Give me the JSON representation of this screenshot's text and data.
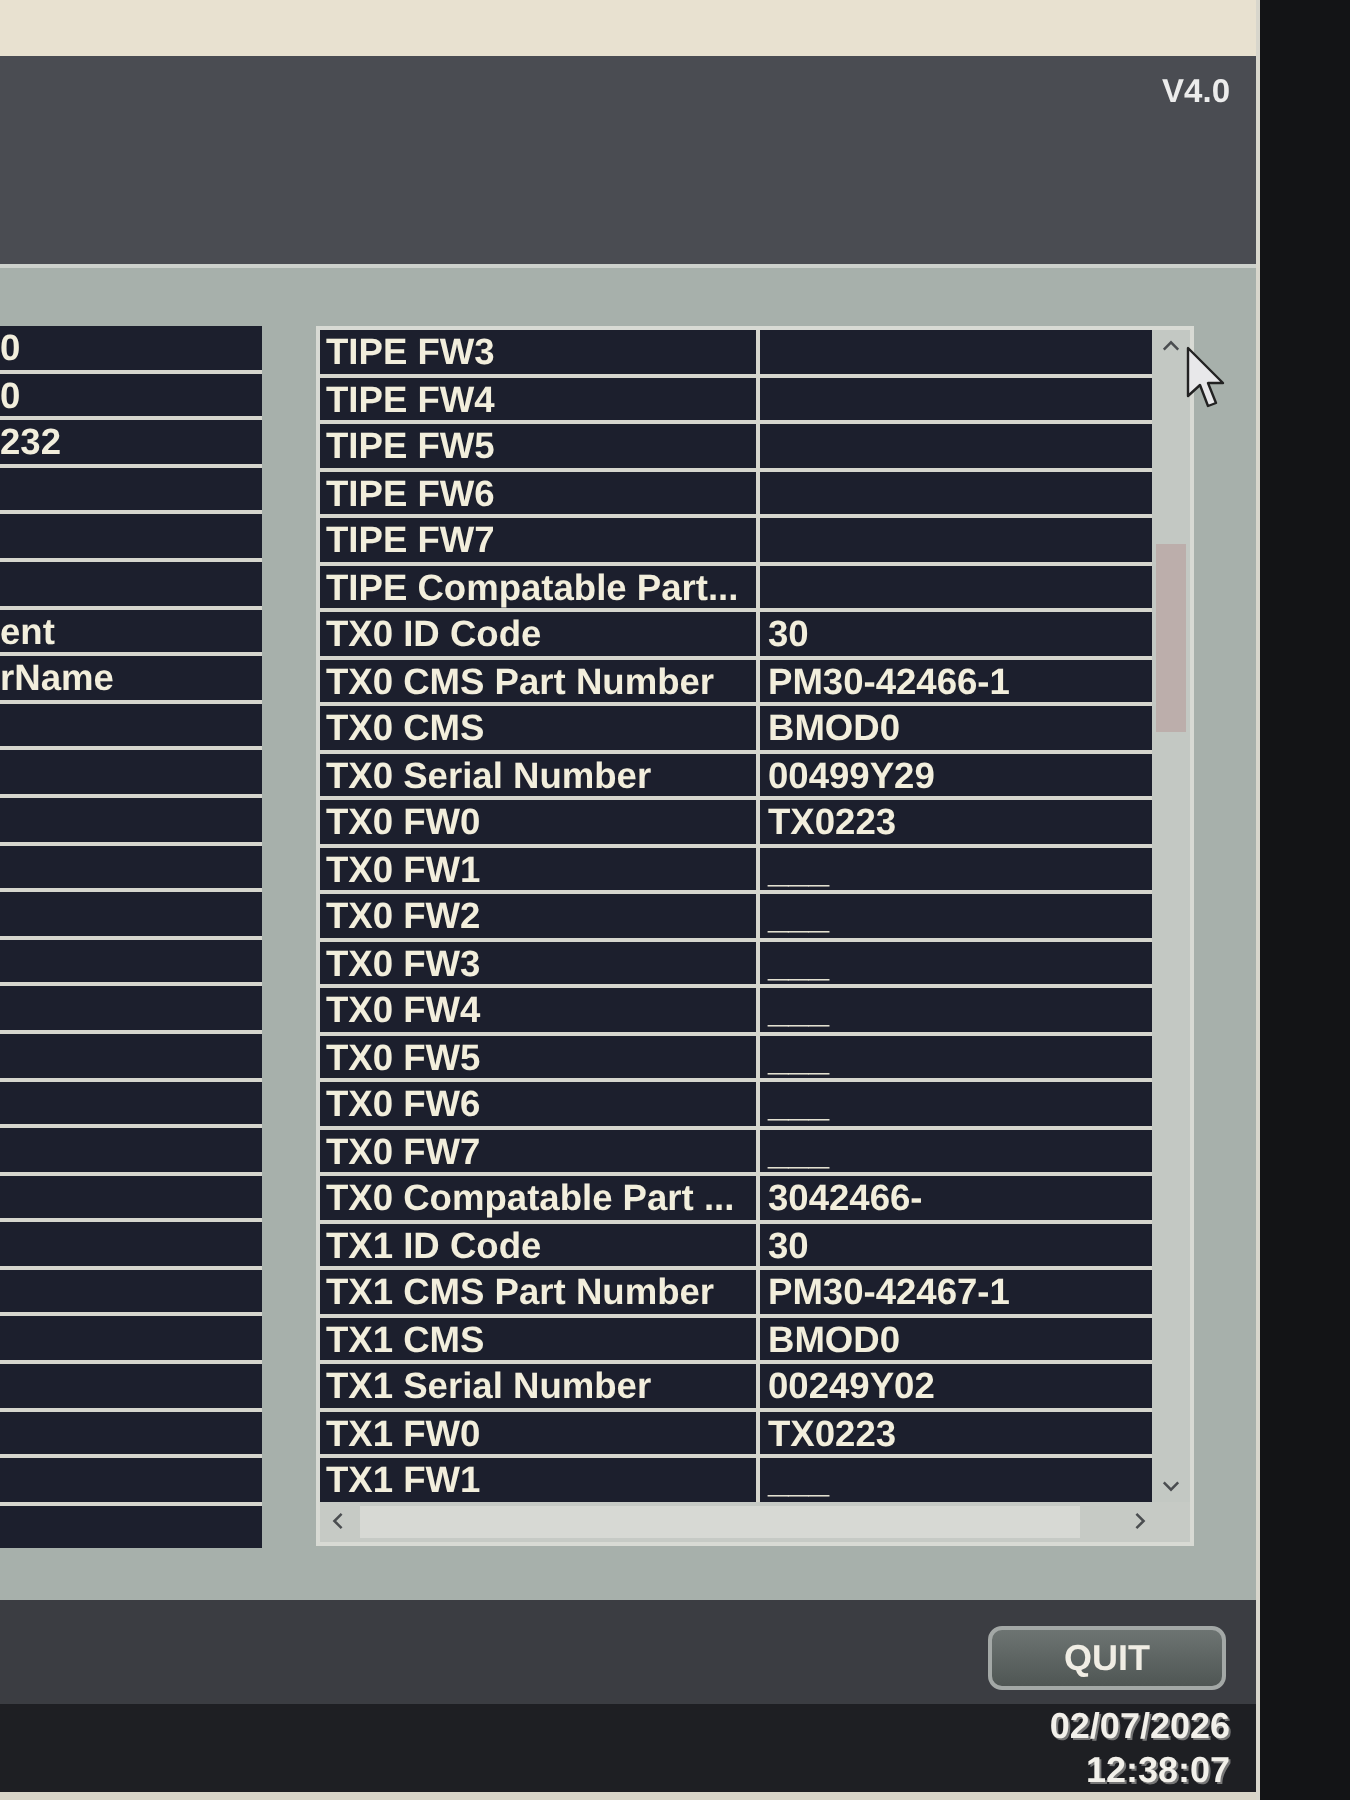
{
  "header": {
    "version": "V4.0"
  },
  "left_table": {
    "rows": [
      {
        "column_1": "0"
      },
      {
        "column_1": "0"
      },
      {
        "column_1": "232"
      },
      {},
      {},
      {},
      {
        "column_1": "ent"
      },
      {
        "column_1": "rName"
      },
      {},
      {},
      {},
      {},
      {},
      {},
      {},
      {},
      {},
      {},
      {},
      {},
      {},
      {},
      {},
      {},
      {},
      {}
    ]
  },
  "right_table": {
    "rows": [
      {
        "column_1": "TIPE FW3"
      },
      {
        "column_1": "TIPE FW4"
      },
      {
        "column_1": "TIPE FW5"
      },
      {
        "column_1": "TIPE FW6"
      },
      {
        "column_1": "TIPE FW7"
      },
      {
        "column_1": "TIPE Compatable Part..."
      },
      {
        "column_1": "TX0 ID Code",
        "column_2": "30"
      },
      {
        "column_1": "TX0 CMS Part Number",
        "column_2": "PM30-42466-1"
      },
      {
        "column_1": "TX0 CMS",
        "column_2": "BMOD0"
      },
      {
        "column_1": "TX0 Serial Number",
        "column_2": "00499Y29"
      },
      {
        "column_1": "TX0 FW0",
        "column_2": "TX0223"
      },
      {
        "column_1": "TX0 FW1",
        "column_2": "___"
      },
      {
        "column_1": "TX0 FW2",
        "column_2": "___"
      },
      {
        "column_1": "TX0 FW3",
        "column_2": "___"
      },
      {
        "column_1": "TX0 FW4",
        "column_2": "___"
      },
      {
        "column_1": "TX0 FW5",
        "column_2": "___"
      },
      {
        "column_1": "TX0 FW6",
        "column_2": "___"
      },
      {
        "column_1": "TX0 FW7",
        "column_2": "___"
      },
      {
        "column_1": "TX0 Compatable Part ...",
        "column_2": "3042466-"
      },
      {
        "column_1": "TX1 ID Code",
        "column_2": "30"
      },
      {
        "column_1": "TX1 CMS Part Number",
        "column_2": "PM30-42467-1"
      },
      {
        "column_1": "TX1 CMS",
        "column_2": "BMOD0"
      },
      {
        "column_1": "TX1 Serial Number",
        "column_2": "00249Y02"
      },
      {
        "column_1": "TX1 FW0",
        "column_2": "TX0223"
      },
      {
        "column_1": "TX1 FW1",
        "column_2": "___"
      }
    ]
  },
  "buttons": [
    {
      "label": "QUIT"
    }
  ],
  "footer": {
    "date": "02/07/2026",
    "time": "12:38:07"
  }
}
